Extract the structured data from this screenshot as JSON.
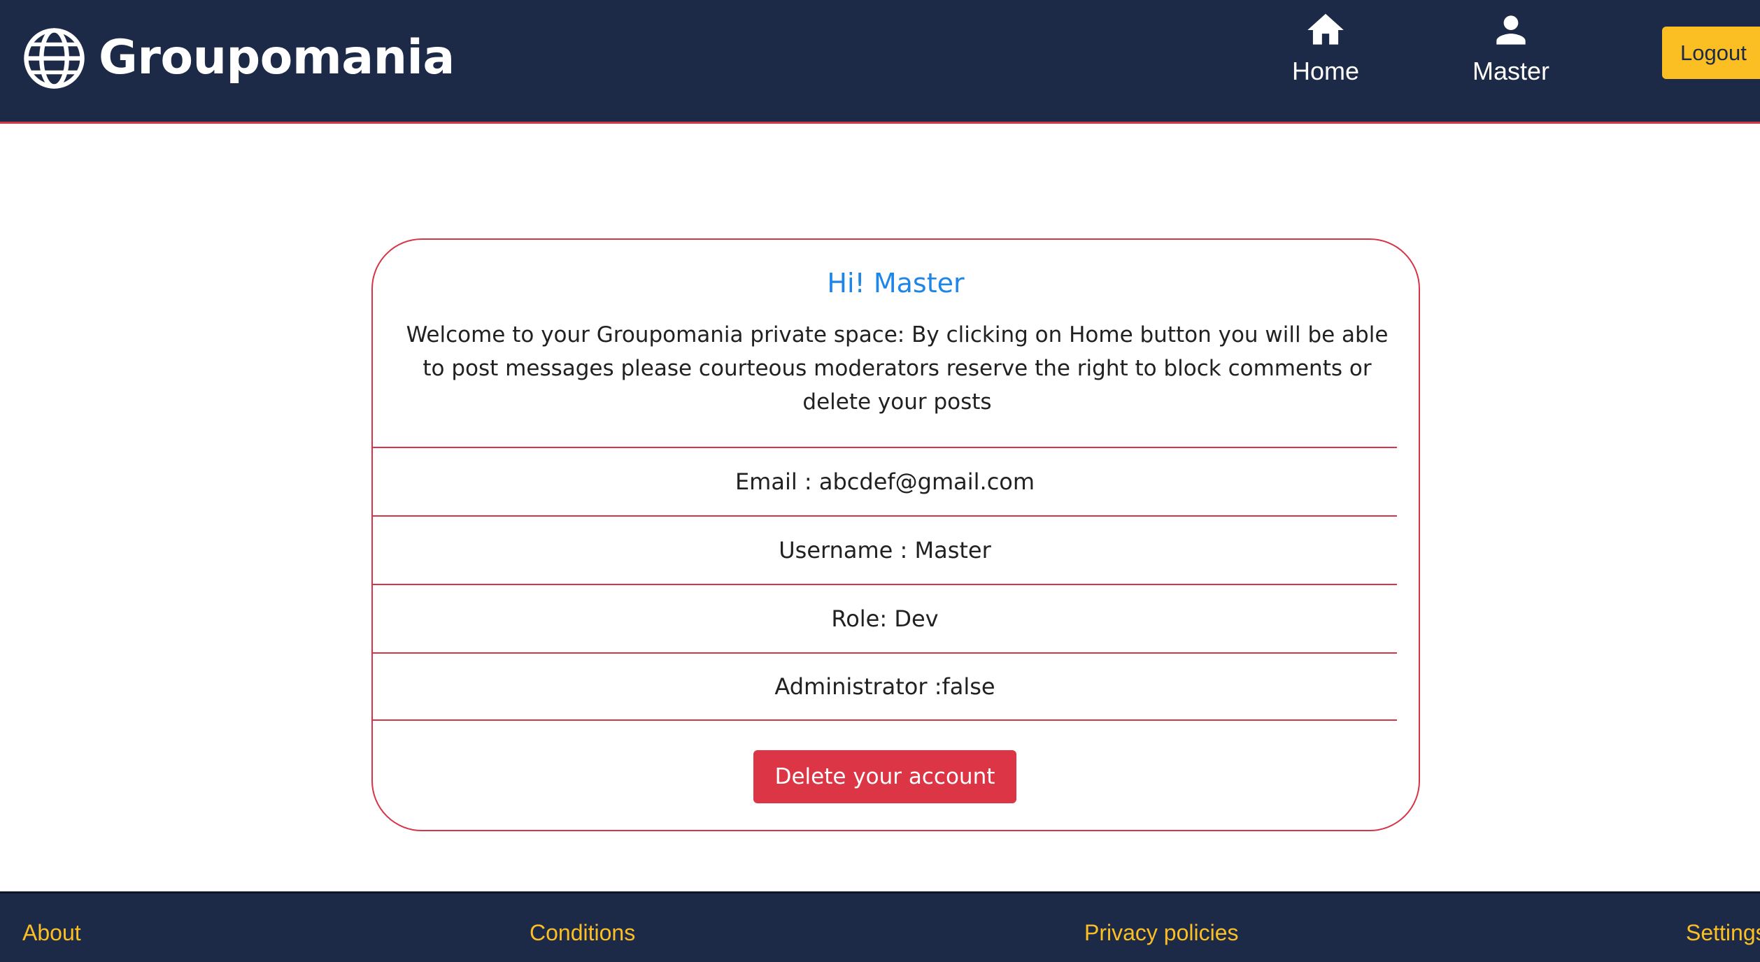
{
  "header": {
    "brand_name": "Groupomania",
    "nav": {
      "home_label": "Home",
      "user_label": "Master"
    },
    "logout_label": "Logout"
  },
  "profile": {
    "greeting": "Hi! Master",
    "welcome_text": "Welcome to your Groupomania private space: By clicking on Home button you will be able to post messages please courteous moderators reserve the right to block comments or delete your posts",
    "email": "Email : abcdef@gmail.com",
    "username": "Username : Master",
    "role": "Role: Dev",
    "administrator": "Administrator :false",
    "delete_label": "Delete your account"
  },
  "footer": {
    "about": "About",
    "conditions": "Conditions",
    "privacy": "Privacy policies",
    "settings": "Settings"
  },
  "icons": {
    "brand": "globe-icon",
    "home": "home-icon",
    "user": "person-icon"
  },
  "colors": {
    "navy": "#1c2a47",
    "accent_red": "#d63447",
    "accent_yellow": "#fbbf24",
    "title_blue": "#1f86e8",
    "delete_red": "#dc3545"
  }
}
